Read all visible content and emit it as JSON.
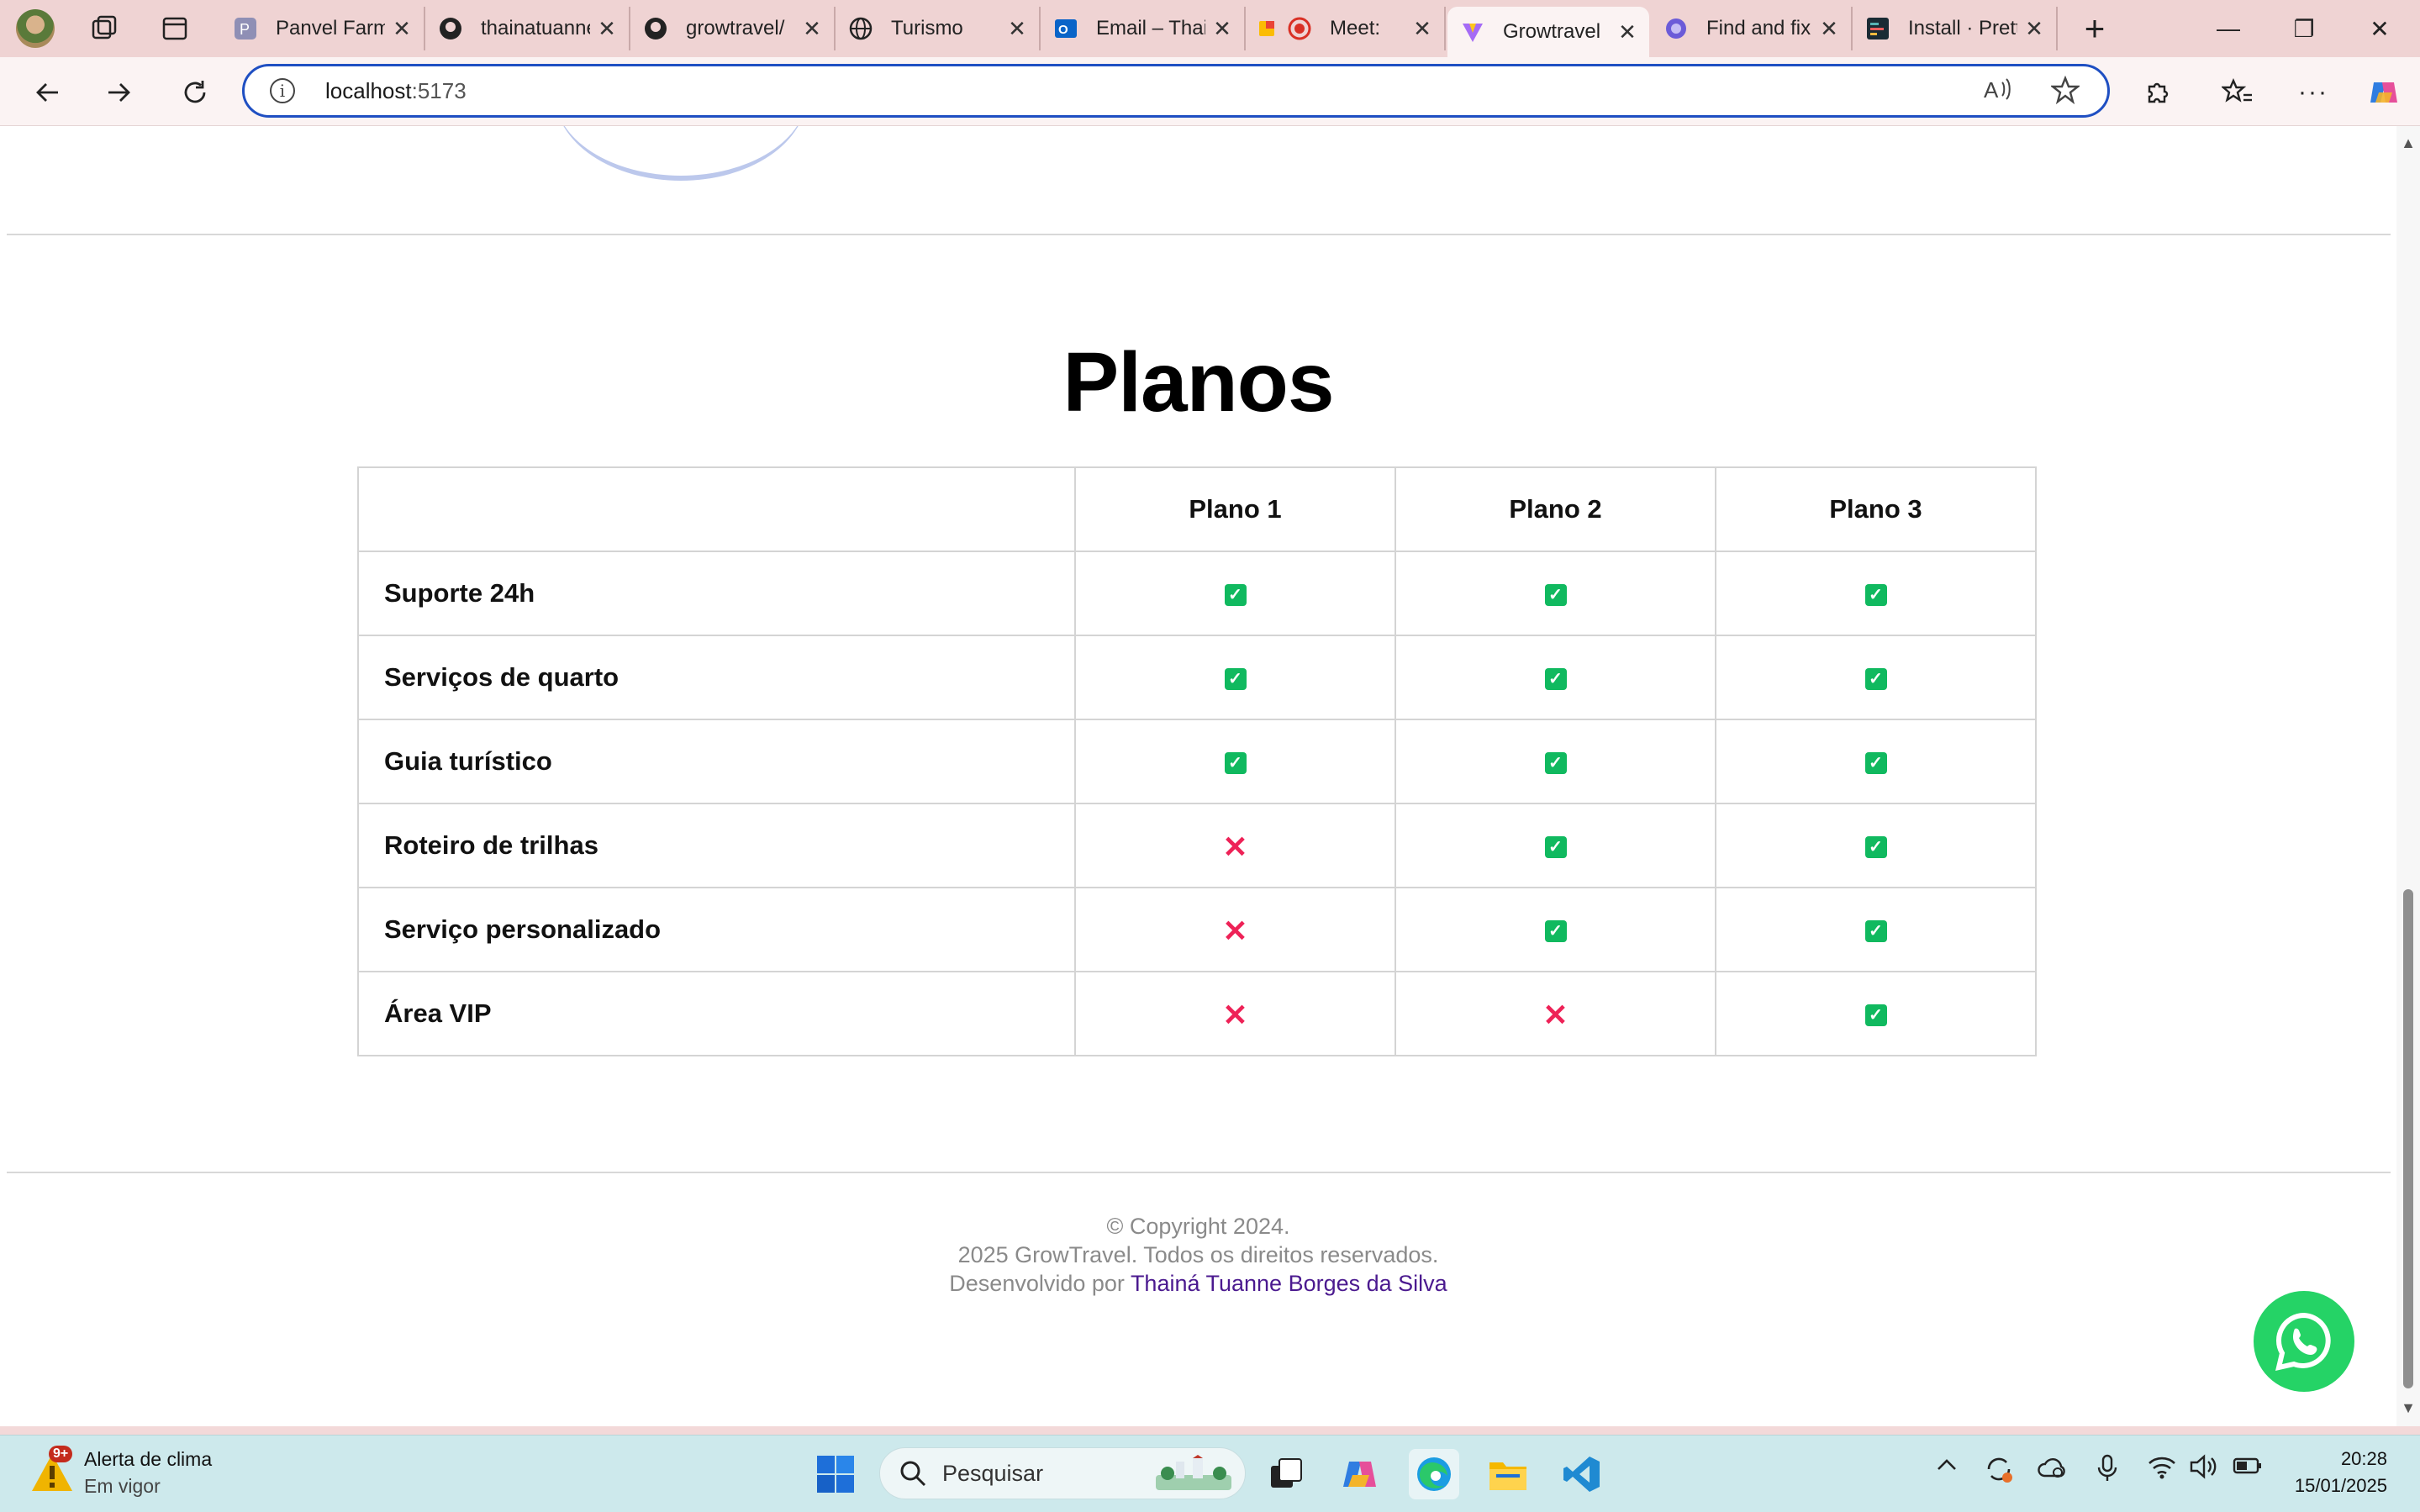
{
  "browser": {
    "tabs": [
      {
        "label": "Panvel Farmácias",
        "icon": "panvel-icon"
      },
      {
        "label": "thainatuanne",
        "icon": "github-icon"
      },
      {
        "label": "growtravel/",
        "icon": "github-icon"
      },
      {
        "label": "Turismo",
        "icon": "globe-icon"
      },
      {
        "label": "Email – Thainá",
        "icon": "outlook-icon"
      },
      {
        "label": "Meet:",
        "icon": "meet-icon"
      },
      {
        "label": "Growtravel",
        "icon": "vite-icon",
        "active": true
      },
      {
        "label": "Find and fix",
        "icon": "copilot-icon"
      },
      {
        "label": "Install · Prettier",
        "icon": "prettier-icon"
      }
    ],
    "close_glyph": "✕",
    "new_tab_glyph": "+",
    "url_host": "localhost",
    "url_port": ":5173",
    "window_controls": {
      "minimize": "—",
      "restore": "❐",
      "close": "✕"
    }
  },
  "page": {
    "section_title": "Planos",
    "table": {
      "columns": [
        "Plano 1",
        "Plano 2",
        "Plano 3"
      ],
      "rows": [
        {
          "feature": "Suporte 24h",
          "values": [
            true,
            true,
            true
          ]
        },
        {
          "feature": "Serviços de quarto",
          "values": [
            true,
            true,
            true
          ]
        },
        {
          "feature": "Guia turístico",
          "values": [
            true,
            true,
            true
          ]
        },
        {
          "feature": "Roteiro de trilhas",
          "values": [
            false,
            true,
            true
          ]
        },
        {
          "feature": "Serviço personalizado",
          "values": [
            false,
            true,
            true
          ]
        },
        {
          "feature": "Área VIP",
          "values": [
            false,
            false,
            true
          ]
        }
      ]
    },
    "footer": {
      "line1": "© Copyright 2024.",
      "line2": "2025 GrowTravel. Todos os direitos reservados.",
      "line3_prefix": "Desenvolvido por ",
      "author": "Thainá Tuanne Borges da Silva"
    },
    "colors": {
      "check": "#10b95f",
      "cross": "#ee2257",
      "author_link": "#4b1a8f",
      "whatsapp": "#25d366"
    }
  },
  "taskbar": {
    "weather_title": "Alerta de clima",
    "weather_sub": "Em vigor",
    "weather_badge": "9+",
    "search_placeholder": "Pesquisar",
    "time": "20:28",
    "date": "15/01/2025"
  }
}
